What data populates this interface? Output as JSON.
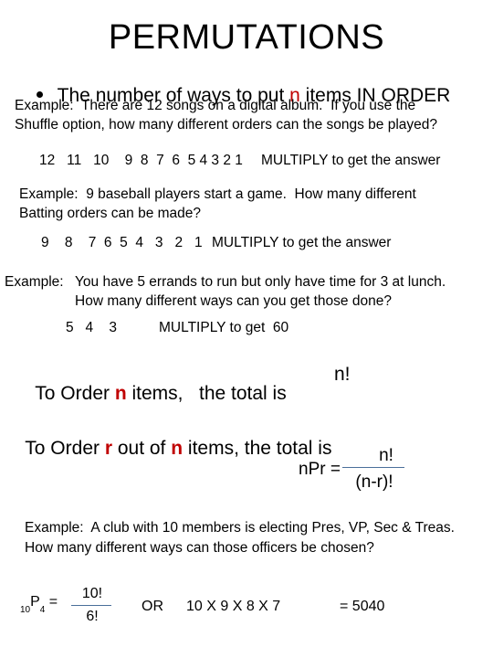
{
  "title": "PERMUTATIONS",
  "bullet": {
    "before": "The number of ways to put ",
    "highlight": "n",
    "after": " items IN ORDER"
  },
  "example1": {
    "line1": "Example:  There are 12 songs on a digital album.  If you use the",
    "line2": "Shuffle option, how many different orders can the songs be played?",
    "sequence": "12   11   10    9  8  7  6  5 4 3 2 1",
    "instruction": "MULTIPLY to get the answer"
  },
  "example2": {
    "line1": "Example:  9 baseball players start a game.  How many different",
    "line2": "Batting orders can be made?",
    "sequence": "9    8    7  6  5  4   3   2   1",
    "instruction": "MULTIPLY to get the answer"
  },
  "example3": {
    "label": "Example:",
    "line1": "You have 5 errands to run but only have time for 3 at lunch.",
    "line2": "How many different ways can you get those done?",
    "sequence": "5   4    3",
    "instruction": "MULTIPLY to get  60"
  },
  "rule1": {
    "before": "To Order ",
    "highlight": "n",
    "after": " items,   the total is",
    "result": "n!"
  },
  "rule2": {
    "before": "To Order ",
    "highlight1": "r",
    "middle": " out of ",
    "highlight2": "n",
    "after": " items, the total is"
  },
  "formula": {
    "lhs": "nPr =",
    "numerator": "n!",
    "denominator": "(n-r)!"
  },
  "example4": {
    "line1": "Example:  A club with 10 members is electing Pres, VP, Sec & Treas.",
    "line2": "How many different ways can those officers be chosen?",
    "perm_pre_sub": "10",
    "perm_symbol": "P",
    "perm_post_sub": "4",
    "equals": " =",
    "numerator": "10!",
    "denominator": "6!",
    "or": "OR",
    "product": "10 X 9 X 8 X 7",
    "answer": "= 5040"
  },
  "colors": {
    "highlight": "#c00000",
    "fraction_line": "#4a6f9a"
  }
}
